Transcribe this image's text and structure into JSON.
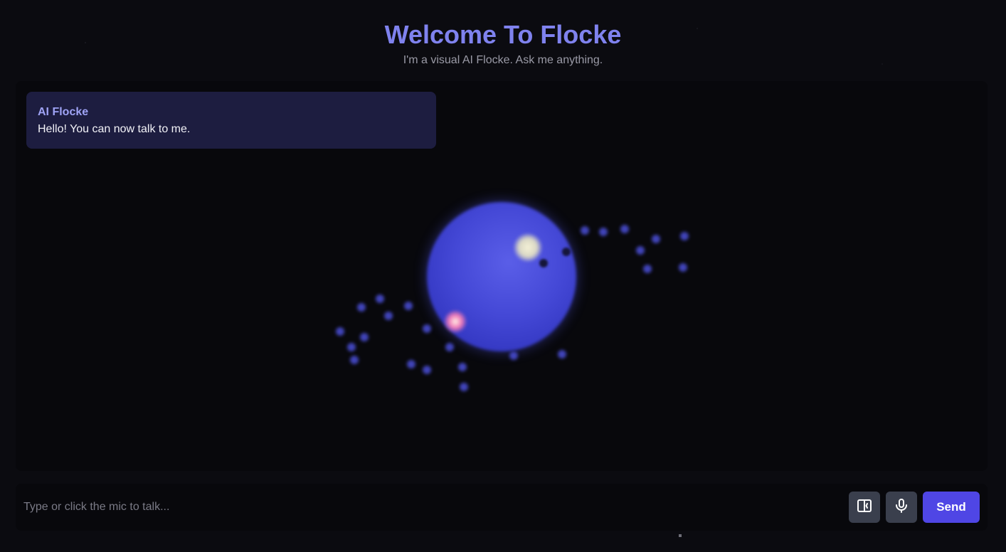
{
  "header": {
    "title": "Welcome To Flocke",
    "subtitle": "I'm a visual AI Flocke. Ask me anything."
  },
  "chat": {
    "messages": [
      {
        "sender": "AI Flocke",
        "text": "Hello! You can now talk to me."
      }
    ]
  },
  "orb": {
    "icon": "ai-orb",
    "colors": {
      "core": "#4448d6",
      "highlight": "#f4f1d6",
      "spark": "#f07ab8",
      "particles": "#4b4fd8"
    }
  },
  "input": {
    "value": "",
    "placeholder": "Type or click the mic to talk..."
  },
  "controls": {
    "layout_icon": "layout-toggle-icon",
    "mic_icon": "microphone-icon",
    "send_label": "Send"
  },
  "colors": {
    "accent": "#7f82ee",
    "button": "#4f46e5",
    "icon_button": "#3a3f4d",
    "message_bg": "#1d1d40",
    "background": "#0b0b10"
  }
}
